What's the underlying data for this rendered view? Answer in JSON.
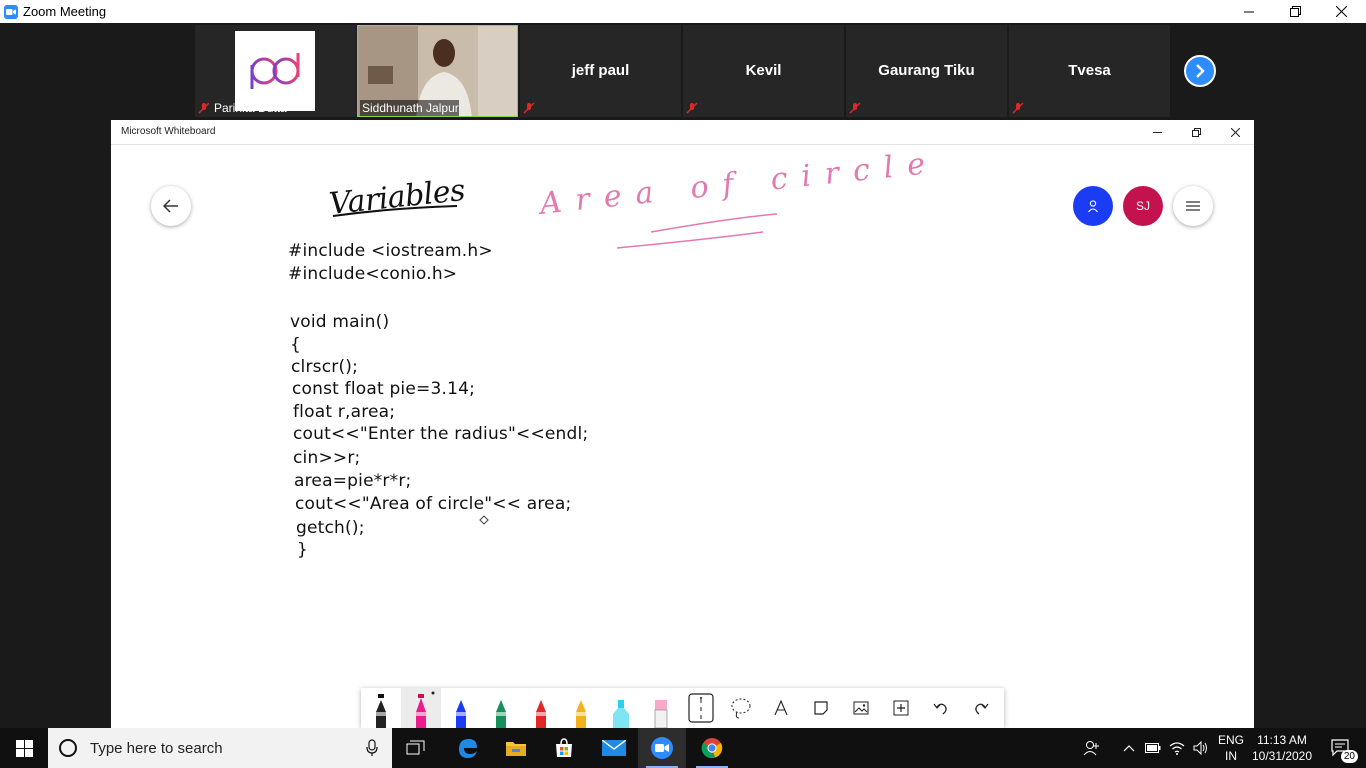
{
  "zoom": {
    "title": "Zoom Meeting",
    "participants": [
      {
        "name": "Parinita Dutta"
      },
      {
        "name": "Siddhunath Jalpur"
      },
      {
        "name": "jeff paul"
      },
      {
        "name": "Kevil"
      },
      {
        "name": "Gaurang Tiku"
      },
      {
        "name": "Tvesa"
      }
    ]
  },
  "whiteboard": {
    "title": "Microsoft Whiteboard",
    "avatar_initials": "SJ",
    "heading": "Variables",
    "pink_note": "Area of circle",
    "code_lines": [
      "#include <iostream.h>",
      "#include<conio.h>",
      "void main()",
      "{",
      "clrscr();",
      "const float pie=3.14;",
      "float r,area;",
      "cout<<\"Enter the radius\"<<endl;",
      "cin>>r;",
      "area=pie*r*r;",
      "cout<<\"Area of circle\"<< area;",
      "getch();",
      "}"
    ],
    "tools": [
      "black-pen",
      "pink-pen",
      "blue-pen",
      "green-pen",
      "red-pen",
      "yellow-pen",
      "highlighter",
      "eraser",
      "ruler",
      "lasso",
      "text",
      "note",
      "image",
      "add",
      "undo",
      "redo"
    ],
    "colors": {
      "pink_ink": "#e07ab0",
      "avatar_blue": "#1a3cf5",
      "avatar_sj": "#c4124f"
    }
  },
  "taskbar": {
    "search_placeholder": "Type here to search",
    "lang_top": "ENG",
    "lang_bottom": "IN",
    "time": "11:13 AM",
    "date": "10/31/2020",
    "notifications": "20"
  }
}
